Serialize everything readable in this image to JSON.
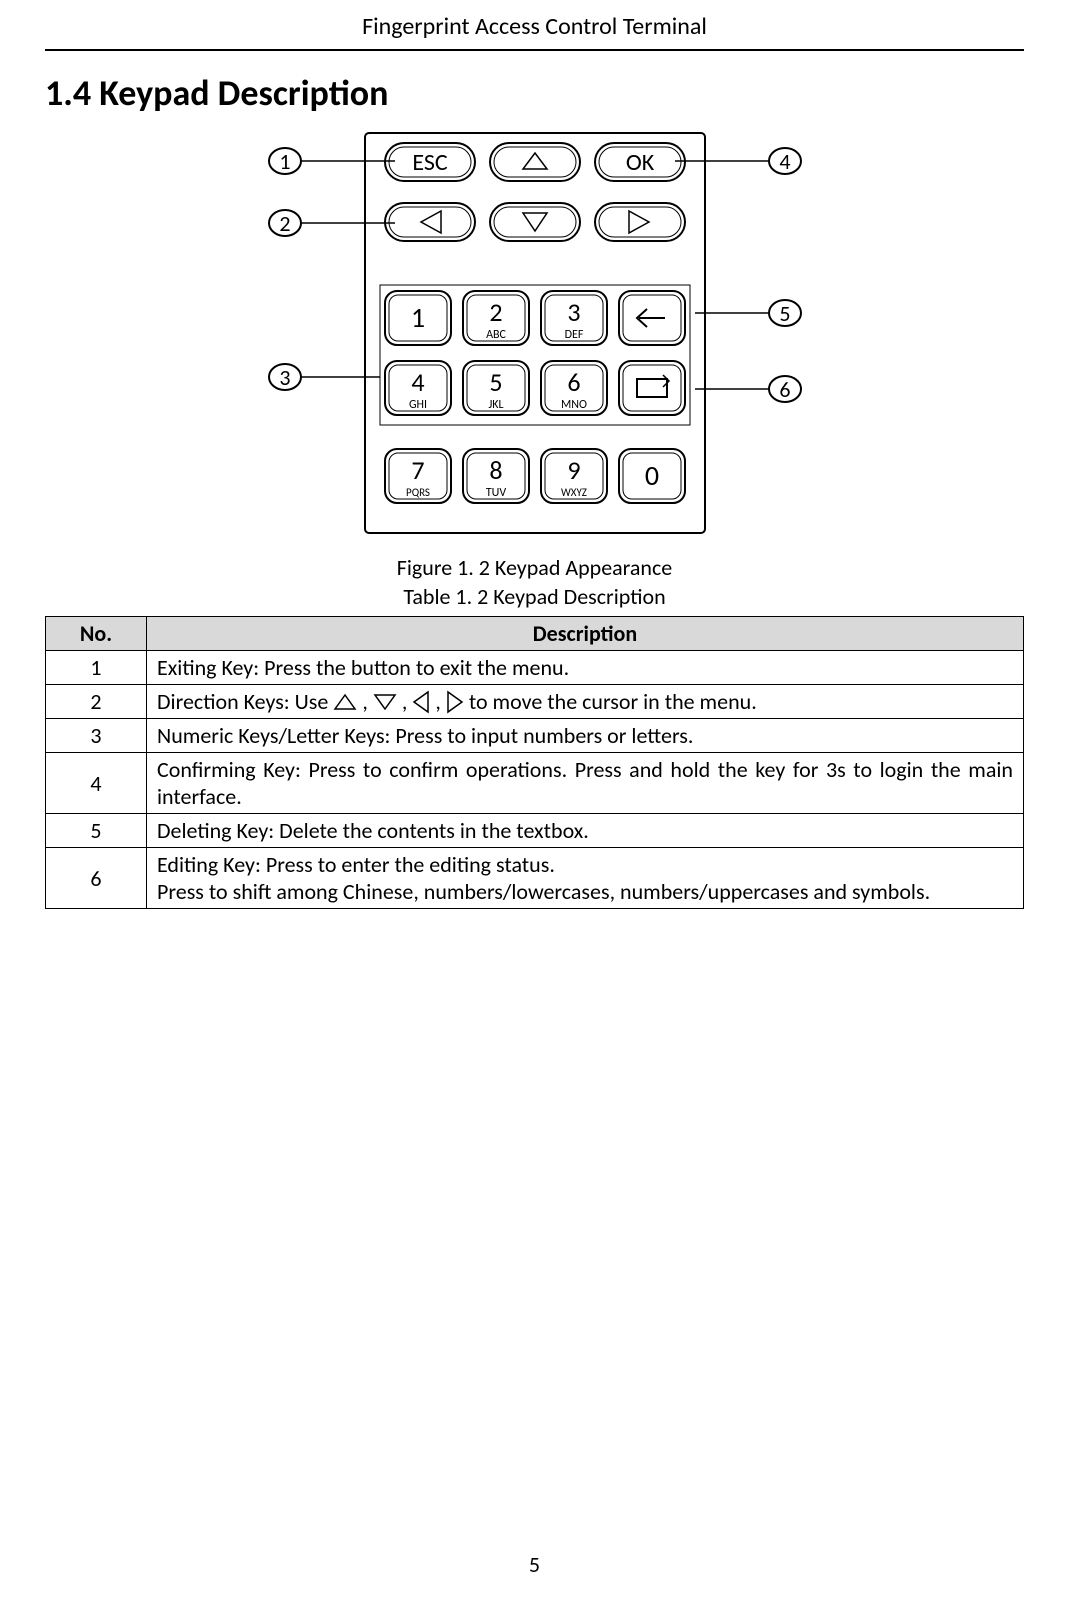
{
  "header": {
    "title": "Fingerprint Access Control Terminal"
  },
  "section": {
    "heading": "1.4 Keypad Description"
  },
  "figure": {
    "caption": "Figure 1. 2 Keypad Appearance"
  },
  "table": {
    "caption": "Table 1. 2 Keypad Description",
    "headers": {
      "no": "No.",
      "desc": "Description"
    },
    "rows": {
      "r1": {
        "no": "1",
        "desc": "Exiting Key: Press the button to exit the menu."
      },
      "r2": {
        "no": "2",
        "desc_pre": "Direction Keys: Use ",
        "desc_post": " to move the cursor in the menu."
      },
      "r3": {
        "no": "3",
        "desc": "Numeric Keys/Letter Keys: Press to input numbers or letters."
      },
      "r4": {
        "no": "4",
        "desc": "Confirming Key: Press to confirm operations. Press and hold the key for 3s to login the main interface."
      },
      "r5": {
        "no": "5",
        "desc": "Deleting Key: Delete the contents in the textbox."
      },
      "r6": {
        "no": "6",
        "desc": "Editing Key: Press to enter the editing status.\nPress to shift among Chinese, numbers/lowercases, numbers/uppercases and symbols."
      }
    }
  },
  "keypad": {
    "esc": "ESC",
    "ok": "OK",
    "keys": {
      "k1": {
        "num": "1",
        "sub": ""
      },
      "k2": {
        "num": "2",
        "sub": "ABC"
      },
      "k3": {
        "num": "3",
        "sub": "DEF"
      },
      "k4": {
        "num": "4",
        "sub": "GHI"
      },
      "k5": {
        "num": "5",
        "sub": "JKL"
      },
      "k6": {
        "num": "6",
        "sub": "MNO"
      },
      "k7": {
        "num": "7",
        "sub": "PQRS"
      },
      "k8": {
        "num": "8",
        "sub": "TUV"
      },
      "k9": {
        "num": "9",
        "sub": "WXYZ"
      },
      "k0": {
        "num": "0",
        "sub": ""
      }
    },
    "callouts": {
      "c1": "1",
      "c2": "2",
      "c3": "3",
      "c4": "4",
      "c5": "5",
      "c6": "6"
    }
  },
  "page_number": "5"
}
